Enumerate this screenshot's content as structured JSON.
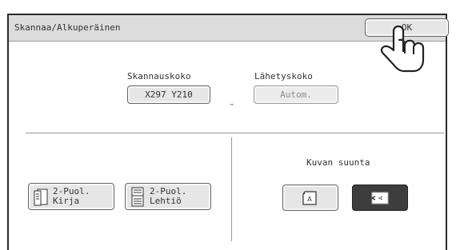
{
  "window": {
    "title": "Skannaa/Alkuperäinen",
    "ok_label": "OK"
  },
  "scan_size": {
    "label": "Skannauskoko",
    "value": "X297  Y210"
  },
  "send_size": {
    "label": "Lähetyskoko",
    "value": "Autom."
  },
  "duplex": {
    "book": {
      "line1": "2-Puol.",
      "line2": "Kirja"
    },
    "tablet": {
      "line1": "2-Puol.",
      "line2": "Lehtiö"
    }
  },
  "orientation": {
    "label": "Kuvan suunta",
    "portrait_letter": "A",
    "landscape_letter": "A",
    "selected": "landscape"
  },
  "colors": {
    "selected_bg": "#3d3d3d",
    "button_bg": "#e6e6e6",
    "titlebar_bg": "#dcdcdc"
  }
}
